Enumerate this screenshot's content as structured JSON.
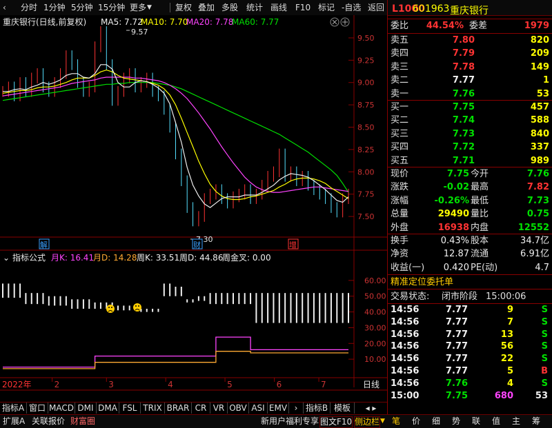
{
  "toolbar": {
    "items": [
      "分时",
      "1分钟",
      "5分钟",
      "15分钟",
      "更多",
      "复权",
      "叠加",
      "多股",
      "统计",
      "画线",
      "F10",
      "标记",
      "-自选",
      "返回"
    ]
  },
  "chart": {
    "title": "重庆银行(日线,前复权)",
    "ma_labels": [
      {
        "text": "MA5: 7.72",
        "color": "#f0f0f0"
      },
      {
        "text": "MA10: 7.70",
        "color": "#ffff00"
      },
      {
        "text": "MA20: 7.78",
        "color": "#ff44ff"
      },
      {
        "text": "MA60: 7.77",
        "color": "#00e000"
      }
    ],
    "y_ticks": [
      "9.50",
      "9.25",
      "9.00",
      "8.75",
      "8.50",
      "8.25",
      "8.00",
      "7.75",
      "7.50"
    ],
    "high_mark": "9.57",
    "low_mark": "7.30",
    "markers": [
      "解",
      "财",
      "增"
    ],
    "price_closes": [
      8.9,
      8.95,
      8.85,
      9.0,
      8.9,
      9.05,
      9.1,
      8.95,
      8.9,
      9.0,
      9.1,
      9.3,
      9.2,
      9.0,
      8.9,
      8.95,
      9.4,
      9.57,
      9.2,
      8.8,
      8.9,
      9.05,
      9.1,
      8.95,
      9.0,
      9.05,
      8.9,
      8.85,
      8.7,
      8.5,
      8.2,
      7.9,
      7.6,
      7.45,
      7.5,
      7.7,
      7.75,
      7.8,
      7.7,
      7.65,
      7.72,
      7.75,
      7.8,
      7.7,
      7.75,
      7.85,
      7.95,
      8.0,
      8.2,
      7.95,
      8.0,
      7.9,
      7.95,
      7.85,
      7.8,
      7.75,
      7.7,
      7.6,
      7.55,
      7.7,
      7.75
    ],
    "ma5": [
      8.9,
      8.9,
      8.92,
      8.93,
      8.92,
      8.95,
      8.97,
      9.0,
      8.98,
      9.0,
      9.03,
      9.08,
      9.1,
      9.1,
      9.06,
      9.05,
      9.1,
      9.2,
      9.2,
      9.15,
      9.0,
      8.95,
      8.95,
      9.0,
      9.02,
      9.01,
      8.98,
      8.94,
      8.88,
      8.76,
      8.55,
      8.33,
      8.05,
      7.85,
      7.73,
      7.64,
      7.6,
      7.65,
      7.7,
      7.72,
      7.72,
      7.72,
      7.74,
      7.74,
      7.74,
      7.77,
      7.81,
      7.85,
      7.91,
      7.95,
      7.98,
      7.97,
      7.96,
      7.94,
      7.9,
      7.85,
      7.8,
      7.74,
      7.68,
      7.66,
      7.72
    ],
    "ma10": [
      8.88,
      8.89,
      8.9,
      8.91,
      8.91,
      8.92,
      8.94,
      8.95,
      8.95,
      8.96,
      8.98,
      9.0,
      9.03,
      9.05,
      9.05,
      9.05,
      9.08,
      9.12,
      9.14,
      9.12,
      9.08,
      9.05,
      9.04,
      9.03,
      9.02,
      9.01,
      8.99,
      8.97,
      8.93,
      8.86,
      8.75,
      8.6,
      8.44,
      8.28,
      8.12,
      7.98,
      7.86,
      7.78,
      7.73,
      7.7,
      7.69,
      7.69,
      7.7,
      7.72,
      7.73,
      7.75,
      7.77,
      7.79,
      7.83,
      7.86,
      7.9,
      7.92,
      7.93,
      7.93,
      7.92,
      7.9,
      7.87,
      7.82,
      7.78,
      7.74,
      7.7
    ],
    "ma20": [
      8.85,
      8.86,
      8.87,
      8.88,
      8.89,
      8.9,
      8.91,
      8.92,
      8.93,
      8.94,
      8.95,
      8.97,
      8.99,
      9.0,
      9.01,
      9.02,
      9.03,
      9.05,
      9.06,
      9.06,
      9.06,
      9.06,
      9.06,
      9.05,
      9.05,
      9.04,
      9.03,
      9.02,
      9.0,
      8.97,
      8.93,
      8.88,
      8.82,
      8.74,
      8.66,
      8.57,
      8.48,
      8.38,
      8.28,
      8.19,
      8.1,
      8.02,
      7.94,
      7.88,
      7.83,
      7.8,
      7.78,
      7.77,
      7.77,
      7.78,
      7.79,
      7.8,
      7.81,
      7.82,
      7.83,
      7.83,
      7.82,
      7.81,
      7.8,
      7.79,
      7.78
    ],
    "ma60": [
      8.8,
      8.81,
      8.82,
      8.83,
      8.84,
      8.85,
      8.86,
      8.87,
      8.88,
      8.89,
      8.9,
      8.91,
      8.92,
      8.93,
      8.94,
      8.95,
      8.96,
      8.97,
      8.98,
      8.98,
      8.99,
      8.99,
      9.0,
      9.0,
      9.0,
      9.0,
      9.0,
      8.99,
      8.98,
      8.97,
      8.95,
      8.93,
      8.9,
      8.87,
      8.84,
      8.81,
      8.78,
      8.75,
      8.72,
      8.69,
      8.66,
      8.63,
      8.6,
      8.57,
      8.54,
      8.51,
      8.48,
      8.45,
      8.42,
      8.38,
      8.34,
      8.3,
      8.26,
      8.22,
      8.17,
      8.12,
      8.07,
      8.02,
      7.96,
      7.87,
      7.77
    ],
    "indicator": {
      "label": "指标公式",
      "values": [
        {
          "text": "月K: 16.41",
          "color": "#ff44ff"
        },
        {
          "text": "月D: 14.28",
          "color": "#ffaa33"
        },
        {
          "text": "周K: 33.51",
          "color": "#f0f0f0"
        },
        {
          "text": "周D: 44.86",
          "color": "#f0f0f0"
        },
        {
          "text": "周金叉: 0.00",
          "color": "#f0f0f0"
        }
      ],
      "y_ticks": [
        "60.00",
        "50.00",
        "40.00",
        "30.00",
        "20.00",
        "10.00"
      ],
      "week_k": [
        58,
        58,
        58,
        58,
        52,
        52,
        52,
        52,
        50,
        50,
        50,
        50,
        48,
        48,
        48,
        48,
        46,
        46,
        46,
        46,
        44,
        44,
        44,
        44,
        42,
        42,
        42,
        42,
        58,
        58,
        56,
        56,
        48,
        48,
        50,
        50,
        52,
        52,
        52,
        52,
        52,
        52,
        52,
        52,
        52,
        52,
        52,
        52,
        52,
        52,
        52,
        52,
        52,
        52,
        52,
        52,
        52,
        52,
        52,
        52,
        52
      ],
      "week_d": [
        49,
        49,
        49,
        49,
        45,
        45,
        45,
        45,
        44,
        44,
        44,
        44,
        42,
        42,
        42,
        42,
        42,
        42,
        42,
        42,
        41,
        41,
        41,
        41,
        40,
        40,
        40,
        40,
        50,
        50,
        50,
        50,
        46,
        46,
        47,
        47,
        45,
        45,
        45,
        45,
        45,
        45,
        45,
        45,
        33,
        33,
        33,
        33,
        33,
        33,
        33,
        33,
        33,
        33,
        33,
        33,
        33,
        33,
        33,
        33,
        33
      ],
      "month_k": [
        5,
        5,
        5,
        5,
        5,
        5,
        5,
        5,
        5,
        5,
        5,
        5,
        5,
        5,
        5,
        5,
        12,
        12,
        12,
        12,
        12,
        12,
        12,
        12,
        12,
        12,
        12,
        12,
        12,
        12,
        12,
        12,
        12,
        12,
        12,
        12,
        12,
        24,
        24,
        24,
        24,
        24,
        24,
        16,
        16,
        16,
        16,
        16,
        16,
        16,
        16,
        16,
        16,
        16,
        16,
        16,
        16,
        16,
        16,
        16,
        16
      ],
      "month_d": [
        4,
        4,
        4,
        4,
        4,
        4,
        4,
        4,
        4,
        4,
        4,
        4,
        4,
        4,
        4,
        4,
        8,
        8,
        8,
        8,
        8,
        8,
        8,
        8,
        8,
        8,
        8,
        8,
        8,
        8,
        8,
        8,
        8,
        8,
        8,
        8,
        8,
        15,
        15,
        15,
        15,
        15,
        15,
        14,
        14,
        14,
        14,
        14,
        14,
        14,
        14,
        14,
        14,
        14,
        14,
        14,
        14,
        14,
        14,
        14,
        14
      ]
    },
    "x_axis": {
      "year": "2022年",
      "months": [
        "2",
        "3",
        "4",
        "5",
        "6",
        "7"
      ],
      "period": "日线"
    }
  },
  "bottom_tabs": [
    "指标A",
    "窗口",
    "MACD",
    "DMI",
    "DMA",
    "FSL",
    "TRIX",
    "BRAR",
    "CR",
    "VR",
    "OBV",
    "ASI",
    "EMV",
    "指标B",
    "模板"
  ],
  "status_bar": {
    "left": [
      "扩展A",
      "关联报价",
      "财富圈"
    ],
    "right": [
      "新用户福利专享",
      "图文F10",
      "侧边栏"
    ],
    "icons": [
      "笔",
      "价",
      "细",
      "势",
      "联",
      "值",
      "主",
      "筹"
    ]
  },
  "quote": {
    "market_tag": "L1000",
    "code": "601963",
    "name": "重庆银行",
    "weibi_label": "委比",
    "weibi_value": "44.54%",
    "weicha_label": "委差",
    "weicha_value": "1979",
    "asks": [
      {
        "label": "卖五",
        "price": "7.80",
        "vol": "820",
        "color": "red"
      },
      {
        "label": "卖四",
        "price": "7.79",
        "vol": "209",
        "color": "red"
      },
      {
        "label": "卖三",
        "price": "7.78",
        "vol": "149",
        "color": "red"
      },
      {
        "label": "卖二",
        "price": "7.77",
        "vol": "1",
        "color": "white"
      },
      {
        "label": "卖一",
        "price": "7.76",
        "vol": "53",
        "color": "green"
      }
    ],
    "bids": [
      {
        "label": "买一",
        "price": "7.75",
        "vol": "457",
        "color": "green"
      },
      {
        "label": "买二",
        "price": "7.74",
        "vol": "588",
        "color": "green"
      },
      {
        "label": "买三",
        "price": "7.73",
        "vol": "840",
        "color": "green"
      },
      {
        "label": "买四",
        "price": "7.72",
        "vol": "337",
        "color": "green"
      },
      {
        "label": "买五",
        "price": "7.71",
        "vol": "989",
        "color": "green"
      }
    ],
    "stats1": [
      {
        "l1": "现价",
        "v1": "7.75",
        "c1": "green",
        "l2": "今开",
        "v2": "7.76",
        "c2": "green"
      },
      {
        "l1": "涨跌",
        "v1": "-0.02",
        "c1": "green",
        "l2": "最高",
        "v2": "7.82",
        "c2": "red"
      },
      {
        "l1": "涨幅",
        "v1": "-0.26%",
        "c1": "green",
        "l2": "最低",
        "v2": "7.73",
        "c2": "green"
      },
      {
        "l1": "总量",
        "v1": "29490",
        "c1": "yellow",
        "l2": "量比",
        "v2": "0.75",
        "c2": "green"
      },
      {
        "l1": "外盘",
        "v1": "16938",
        "c1": "red",
        "l2": "内盘",
        "v2": "12552",
        "c2": "green"
      }
    ],
    "stats2": [
      {
        "l1": "换手",
        "v1": "0.43%",
        "l2": "股本",
        "v2": "34.7亿"
      },
      {
        "l1": "净资",
        "v1": "12.87",
        "l2": "流通",
        "v2": "6.91亿"
      },
      {
        "l1": "收益(一)",
        "v1": "0.420",
        "l2": "PE(动)",
        "v2": "4.7"
      }
    ],
    "precise_title": "精准定位委托单",
    "trade_status_label": "交易状态:",
    "trade_status_value": "闭市阶段",
    "trade_time": "15:00:06",
    "ticks": [
      {
        "time": "14:56",
        "price": "7.77",
        "pc": "white",
        "vol": "9",
        "vc": "yellow",
        "side": "S",
        "sc": "green"
      },
      {
        "time": "14:56",
        "price": "7.77",
        "pc": "white",
        "vol": "7",
        "vc": "yellow",
        "side": "S",
        "sc": "green"
      },
      {
        "time": "14:56",
        "price": "7.77",
        "pc": "white",
        "vol": "13",
        "vc": "yellow",
        "side": "S",
        "sc": "green"
      },
      {
        "time": "14:56",
        "price": "7.77",
        "pc": "white",
        "vol": "56",
        "vc": "yellow",
        "side": "S",
        "sc": "green"
      },
      {
        "time": "14:56",
        "price": "7.77",
        "pc": "white",
        "vol": "22",
        "vc": "yellow",
        "side": "S",
        "sc": "green"
      },
      {
        "time": "14:56",
        "price": "7.77",
        "pc": "white",
        "vol": "5",
        "vc": "yellow",
        "side": "B",
        "sc": "red"
      },
      {
        "time": "14:56",
        "price": "7.76",
        "pc": "green",
        "vol": "4",
        "vc": "yellow",
        "side": "S",
        "sc": "green"
      },
      {
        "time": "15:00",
        "price": "7.75",
        "pc": "green",
        "vol": "680",
        "vc": "magenta",
        "side": "53",
        "sc": "white"
      }
    ]
  }
}
